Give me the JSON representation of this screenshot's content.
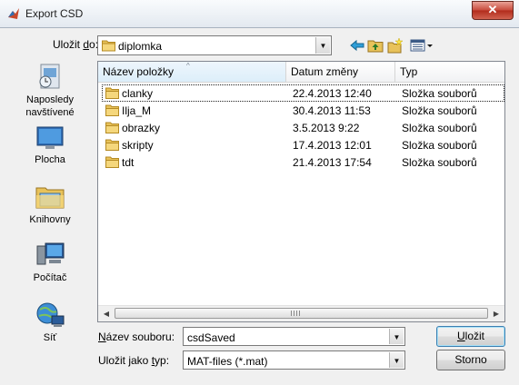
{
  "window": {
    "title": "Export CSD",
    "close_glyph": "✕"
  },
  "toolbar": {
    "look_in_label_pre": "Uložit ",
    "look_in_label_u": "d",
    "look_in_label_post": "o:",
    "look_in_value": "diplomka",
    "icons": [
      "back-arrow-icon",
      "up-folder-icon",
      "new-folder-icon",
      "view-menu-icon"
    ]
  },
  "places": [
    {
      "label": "Naposledy navštívené",
      "icon": "recent-places-icon"
    },
    {
      "label": "Plocha",
      "icon": "desktop-icon"
    },
    {
      "label": "Knihovny",
      "icon": "libraries-icon"
    },
    {
      "label": "Počítač",
      "icon": "computer-icon"
    },
    {
      "label": "Síť",
      "icon": "network-icon"
    }
  ],
  "columns": {
    "name": "Název položky",
    "date": "Datum změny",
    "type": "Typ",
    "sort_glyph": "^"
  },
  "rows": [
    {
      "name": "clanky",
      "date": "22.4.2013 12:40",
      "type": "Složka souborů"
    },
    {
      "name": "Ilja_M",
      "date": "30.4.2013 11:53",
      "type": "Složka souborů"
    },
    {
      "name": "obrazky",
      "date": "3.5.2013 9:22",
      "type": "Složka souborů"
    },
    {
      "name": "skripty",
      "date": "17.4.2013 12:01",
      "type": "Složka souborů"
    },
    {
      "name": "tdt",
      "date": "21.4.2013 17:54",
      "type": "Složka souborů"
    }
  ],
  "form": {
    "filename_label_u": "N",
    "filename_label_rest": "ázev souboru:",
    "filename_value": "csdSaved",
    "filetype_label_pre": "Uložit jako ",
    "filetype_label_u": "t",
    "filetype_label_post": "yp:",
    "filetype_value": "MAT-files (*.mat)"
  },
  "buttons": {
    "save_u": "U",
    "save_rest": "ložit",
    "cancel": "Storno"
  },
  "colors": {
    "folder": "#e8c25a",
    "accent": "#3c7fb1",
    "close": "#c7493a"
  }
}
